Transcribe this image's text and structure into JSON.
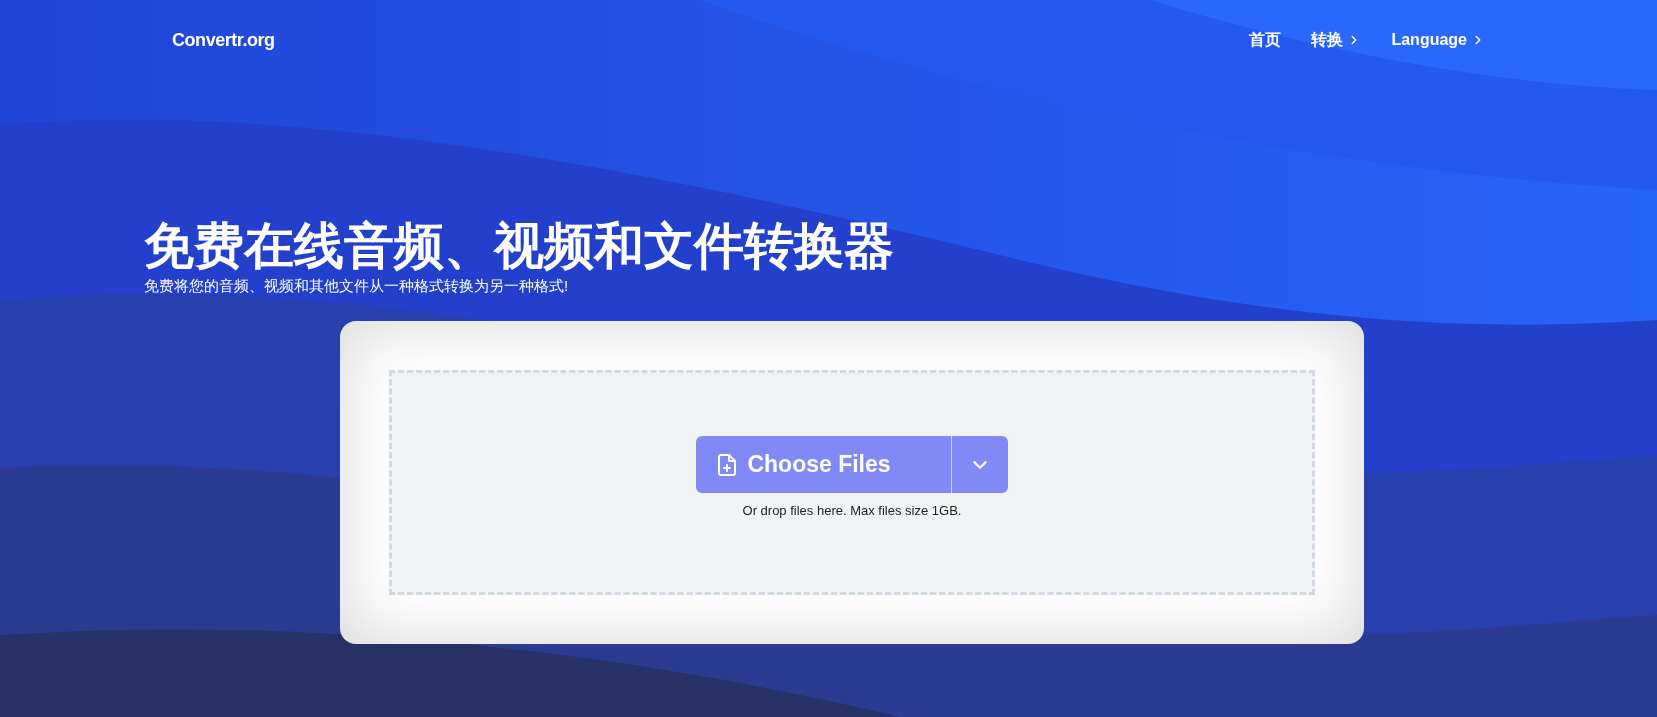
{
  "header": {
    "logo": "Convertr.org",
    "nav": [
      {
        "label": "首页",
        "has_menu": false
      },
      {
        "label": "转换",
        "has_menu": true
      },
      {
        "label": "Language",
        "has_menu": true
      }
    ]
  },
  "hero": {
    "title": "免费在线音频、视频和文件转换器",
    "subtitle": "免费将您的音频、视频和其他文件从一种格式转换为另一种格式!"
  },
  "upload": {
    "button": "Choose Files",
    "hint": "Or drop files here. Max files size 1GB."
  }
}
